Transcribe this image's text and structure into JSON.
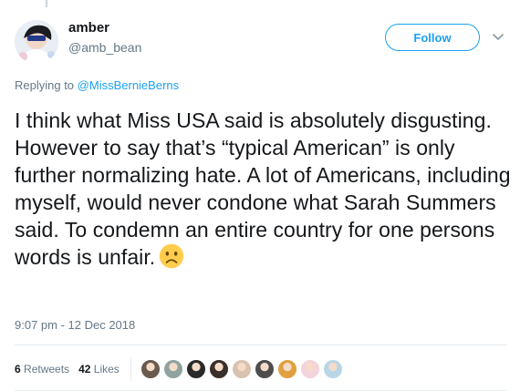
{
  "author": {
    "display_name": "amber",
    "handle": "@amb_bean"
  },
  "actions": {
    "follow_label": "Follow",
    "caret_icon": "chevron-down-icon"
  },
  "reply_context": {
    "prefix": "Replying to",
    "target": "@MissBernieBerns"
  },
  "tweet": {
    "text": "I think what Miss USA said is absolutely disgusting. However to say that’s “typical American” is only further normalizing hate. A lot of Americans, including myself, would never condone what Sarah Summers said. To condemn an entire country for one persons words is unfair.",
    "emoji": "frowning-face-emoji",
    "timestamp": "9:07 pm - 12 Dec 2018"
  },
  "stats": {
    "retweets_count": "6",
    "retweets_label": "Retweets",
    "likes_count": "42",
    "likes_label": "Likes"
  },
  "likers": [
    {
      "color": "#6b5a4e"
    },
    {
      "color": "#8fa3a1"
    },
    {
      "color": "#2a2a2a"
    },
    {
      "color": "#3b2f2a"
    },
    {
      "color": "#d9c2b0"
    },
    {
      "color": "#4d4d4d"
    },
    {
      "color": "#e0a040"
    },
    {
      "color": "#f3d3dc"
    },
    {
      "color": "#b9d6e6"
    }
  ],
  "colors": {
    "accent": "#1da1f2",
    "secondary_text": "#657786",
    "divider": "#e6ecf0"
  }
}
